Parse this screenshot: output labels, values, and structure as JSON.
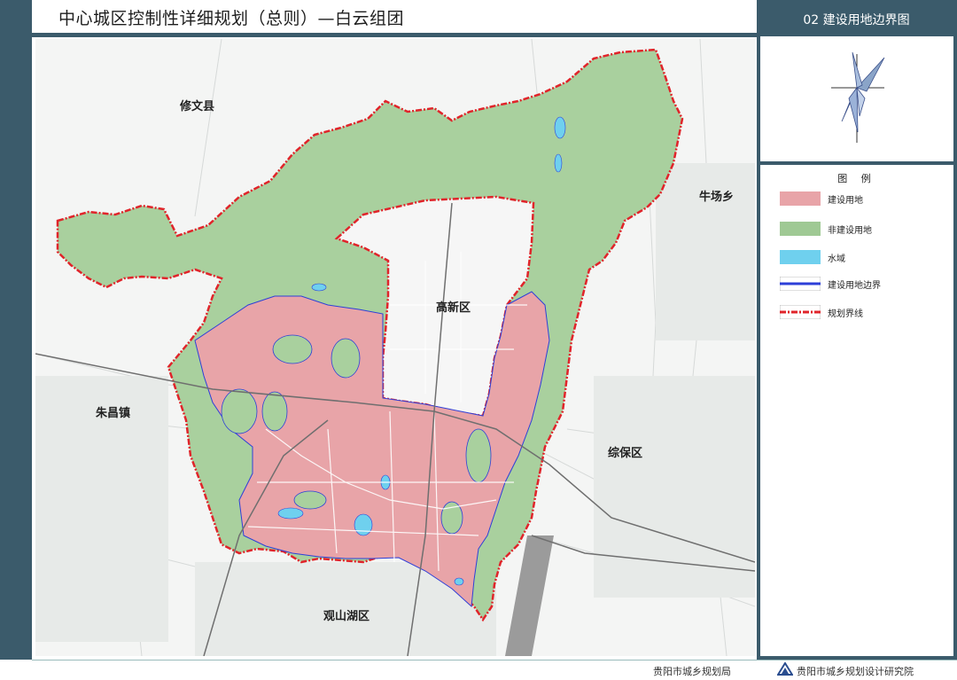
{
  "header": {
    "title": "中心城区控制性详细规划（总则）—白云组团"
  },
  "sheet": {
    "title": "02 建设用地边界图"
  },
  "map": {
    "place_labels": {
      "xiuwen": "修文县",
      "niuchang": "牛场乡",
      "gaoxin": "高新区",
      "zhuchang": "朱昌镇",
      "zongbao": "综保区",
      "guanshanhu": "观山湖区"
    }
  },
  "legend": {
    "title": "图 例",
    "items": [
      {
        "label": "建设用地",
        "color": "#e8a4a8"
      },
      {
        "label": "非建设用地",
        "color": "#9fc994"
      },
      {
        "label": "水域",
        "color": "#6fd0ee"
      },
      {
        "label": "建设用地边界",
        "color": "#2d3fd8"
      },
      {
        "label": "规划界线",
        "color": "#e0242a"
      }
    ]
  },
  "footer": {
    "left": "贵阳市城乡规划局",
    "right": "贵阳市城乡规划设计研究院"
  },
  "colors": {
    "frame": "#3b5b6b",
    "construction_land": "#e8a4a8",
    "non_construction_land": "#a9d09e",
    "water": "#6fd0ee",
    "boundary": "#2d3fd8",
    "planning_line": "#e0242a"
  }
}
